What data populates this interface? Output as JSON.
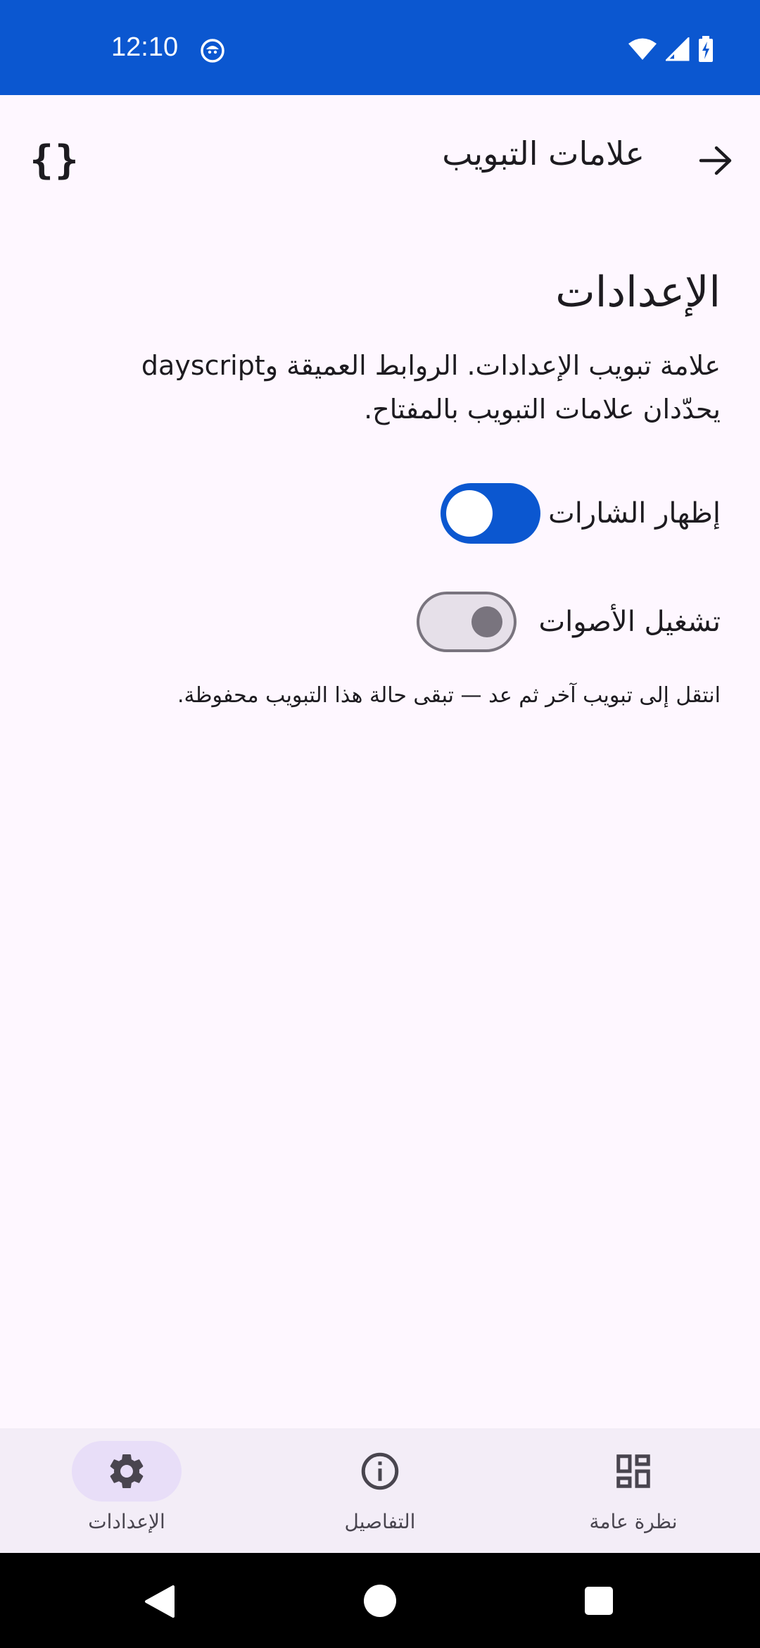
{
  "status_bar": {
    "time": "12:10",
    "background": "#0B57D0"
  },
  "top_bar": {
    "title": "علامات التبويب",
    "back_icon": "arrow-right-icon",
    "action_icon": "code-braces-icon",
    "action_label": "{}"
  },
  "content": {
    "title": "الإعدادات",
    "description": "علامة تبويب الإعدادات. الروابط العميقة وdayscript يحدّدان علامات التبويب بالمفتاح.",
    "toggles": [
      {
        "label": "إظهار الشارات",
        "state": "on"
      },
      {
        "label": "تشغيل الأصوات",
        "state": "off"
      }
    ],
    "hint": "انتقل إلى تبويب آخر ثم عد — تبقى حالة هذا التبويب محفوظة."
  },
  "bottom_nav": {
    "items": [
      {
        "label": "الإعدادات",
        "icon": "gear-icon",
        "active": true
      },
      {
        "label": "التفاصيل",
        "icon": "info-icon",
        "active": false
      },
      {
        "label": "نظرة عامة",
        "icon": "dashboard-icon",
        "active": false
      }
    ]
  },
  "colors": {
    "accent": "#0B57D0",
    "background": "#FEF7FF",
    "nav_background": "#F3EDF7",
    "active_pill": "#E8DEF8"
  }
}
